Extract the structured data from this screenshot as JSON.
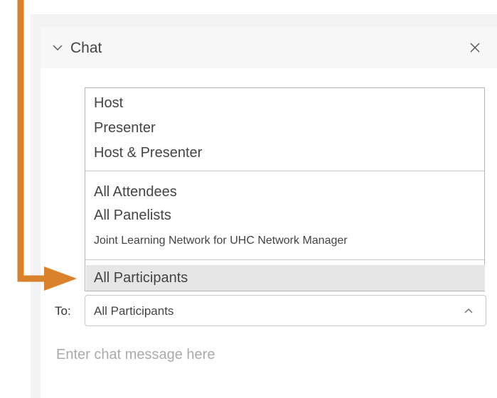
{
  "chat": {
    "title": "Chat",
    "menu_group_1": [
      "Host",
      "Presenter",
      "Host & Presenter"
    ],
    "menu_group_2": [
      "All Attendees",
      "All Panelists",
      "Joint Learning Network for UHC Network Manager"
    ],
    "menu_selected": "All Participants",
    "to_label": "To:",
    "to_value": "All Participants",
    "message_placeholder": "Enter chat message here"
  },
  "colors": {
    "annotation_arrow": "#d9822b",
    "selected_row": "#e6e6e6"
  },
  "icons": {
    "collapse": "chevron-down-icon",
    "close": "close-icon",
    "select_caret": "chevron-up-icon"
  }
}
